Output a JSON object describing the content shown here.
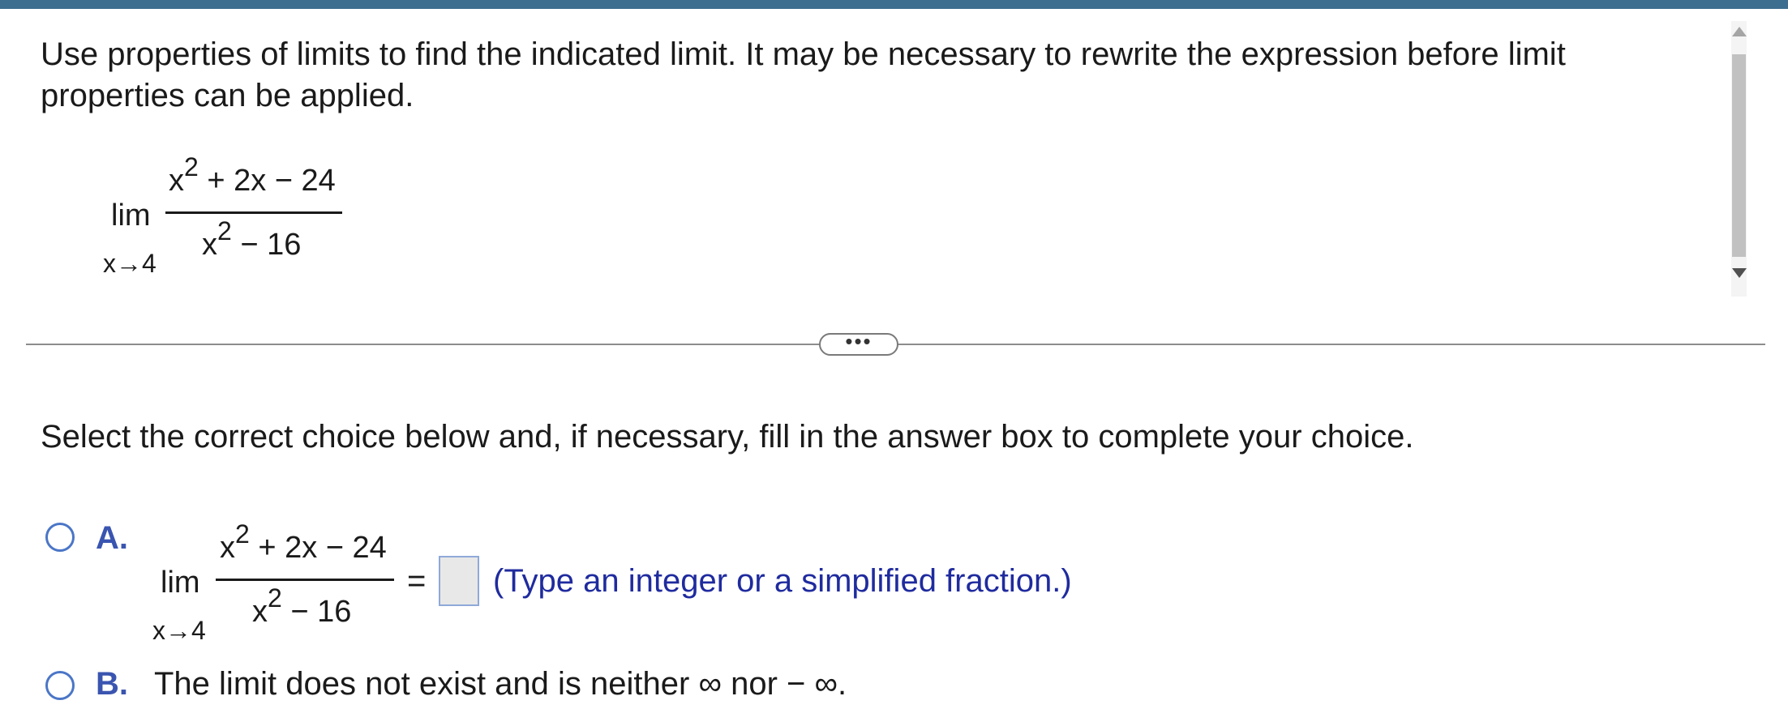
{
  "instructions": "Use properties of limits to find the indicated limit. It may be necessary to rewrite the expression before limit properties can be applied.",
  "problem": {
    "lim": "lim",
    "sub": "x→4",
    "num_base": "x",
    "num_exp": "2",
    "num_rest": " + 2x − 24",
    "den_base": "x",
    "den_exp": "2",
    "den_rest": " − 16"
  },
  "more_button": "•••",
  "prompt": "Select the correct choice below and, if necessary,  fill in the answer box to complete your choice.",
  "choices": {
    "a": {
      "letter": "A.",
      "lim": "lim",
      "sub": "x→4",
      "num_base": "x",
      "num_exp": "2",
      "num_rest": " + 2x − 24",
      "den_base": "x",
      "den_exp": "2",
      "den_rest": " − 16",
      "equals": "=",
      "answer_value": "",
      "hint": "(Type an integer or a simplified fraction.)"
    },
    "b": {
      "letter": "B.",
      "text": "The limit does not exist and is neither ∞ nor  − ∞."
    }
  },
  "colors": {
    "topbar": "#3d6e8f",
    "accent": "#3a55b0",
    "hint": "#1f2b9e",
    "radio_border": "#4b76c7"
  }
}
